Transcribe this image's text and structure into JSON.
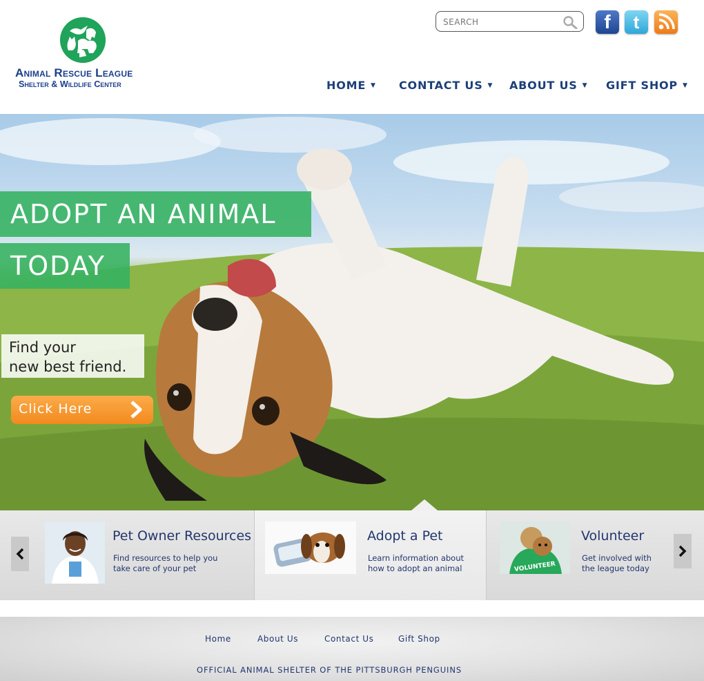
{
  "header": {
    "logo": {
      "title": "Animal Rescue League",
      "subtitle": "Shelter & Wildlife Center"
    },
    "search": {
      "placeholder": "SEARCH"
    },
    "social": {
      "facebook_icon": "facebook-icon",
      "twitter_icon": "twitter-icon",
      "rss_icon": "rss-icon"
    },
    "nav": [
      {
        "label": "HOME"
      },
      {
        "label": "CONTACT US"
      },
      {
        "label": "ABOUT US"
      },
      {
        "label": "GIFT SHOP"
      }
    ]
  },
  "hero": {
    "headline_line1": "ADOPT AN ANIMAL",
    "headline_line2": "TODAY",
    "tagline_line1": "Find your",
    "tagline_line2": "new best friend.",
    "cta_label": "Click Here"
  },
  "features": [
    {
      "title": "Pet Owner Resources",
      "desc_line1": "Find resources to help you",
      "desc_line2": "take care of your pet"
    },
    {
      "title": "Adopt a Pet",
      "desc_line1": "Learn information about",
      "desc_line2": "how to adopt an animal"
    },
    {
      "title": "Volunteer",
      "desc_line1": "Get involved with",
      "desc_line2": "the league today",
      "shirt_text": "VOLUNTEER"
    }
  ],
  "footer": {
    "links": [
      {
        "label": "Home"
      },
      {
        "label": "About Us"
      },
      {
        "label": "Contact Us"
      },
      {
        "label": "Gift Shop"
      }
    ],
    "tagline": "OFFICIAL ANIMAL SHELTER OF THE PITTSBURGH PENGUINS"
  },
  "colors": {
    "brand_navy": "#1b3f8b",
    "brand_green": "#20a35a",
    "cta_orange": "#f28a1e"
  }
}
